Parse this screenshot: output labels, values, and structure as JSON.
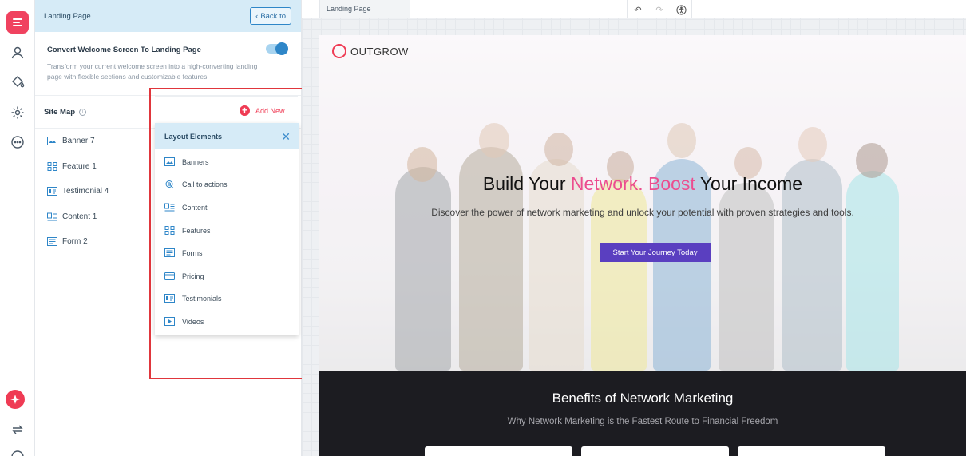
{
  "panel": {
    "title": "Landing Page",
    "back_label": "Back to",
    "convert_title": "Convert Welcome Screen To Landing Page",
    "convert_desc": "Transform your current welcome screen into a high-converting landing page with flexible sections and customizable features.",
    "convert_enabled": true,
    "sitemap_label": "Site Map",
    "info_glyph": "i",
    "add_new_label": "Add New",
    "sitemap_items": [
      {
        "label": "Banner 7",
        "icon": "banner-icon"
      },
      {
        "label": "Feature 1",
        "icon": "feature-icon"
      },
      {
        "label": "Testimonial 4",
        "icon": "testimonial-icon"
      },
      {
        "label": "Content 1",
        "icon": "content-icon"
      },
      {
        "label": "Form 2",
        "icon": "form-icon"
      }
    ]
  },
  "layout_elements": {
    "title": "Layout Elements",
    "items": [
      {
        "label": "Banners",
        "icon": "banner-icon"
      },
      {
        "label": "Call to actions",
        "icon": "cta-icon"
      },
      {
        "label": "Content",
        "icon": "content-icon"
      },
      {
        "label": "Features",
        "icon": "feature-icon"
      },
      {
        "label": "Forms",
        "icon": "form-icon"
      },
      {
        "label": "Pricing",
        "icon": "pricing-icon"
      },
      {
        "label": "Testimonials",
        "icon": "testimonial-icon"
      },
      {
        "label": "Videos",
        "icon": "video-icon"
      }
    ]
  },
  "canvas": {
    "tab_label": "Landing Page",
    "brand": "OUTGROW",
    "hero_title_1": "Build Your",
    "hero_title_pink": "Network. Boost",
    "hero_title_2": "Your Income",
    "hero_sub": "Discover the power of network marketing and unlock your potential with proven strategies and tools.",
    "cta_label": "Start Your Journey Today",
    "benefits_title": "Benefits of Network Marketing",
    "benefits_sub": "Why Network Marketing is the Fastest Route to Financial Freedom"
  },
  "colors": {
    "accent": "#2e86c8",
    "brand_red": "#ef3b54",
    "cta_purple": "#5a3fc0",
    "highlight_pink": "#ec4d8f"
  }
}
